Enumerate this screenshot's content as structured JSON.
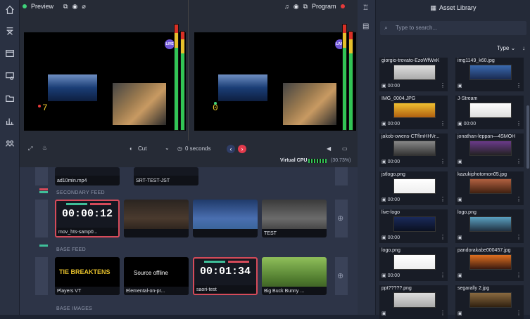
{
  "preview": {
    "title": "Preview",
    "counter": "7"
  },
  "program": {
    "title": "Program",
    "counter": "0"
  },
  "live_label": "LIVE",
  "controls": {
    "transition": "Cut",
    "duration": "0 seconds"
  },
  "virtual_cpu": {
    "label": "Virtual CPU",
    "value": "(30.73%)"
  },
  "top_row": {
    "items": [
      "ad10min.mp4",
      "SRT-TEST-JST"
    ]
  },
  "secondary_feed": {
    "label": "SECONDARY FEED",
    "items": [
      {
        "name": "mov_hts-samp0...",
        "timer": "00:00:12"
      },
      {
        "name": ""
      },
      {
        "name": ""
      },
      {
        "name": "TEST"
      }
    ]
  },
  "base_feed": {
    "label": "BASE FEED",
    "items": [
      {
        "name": "Players VT",
        "overlay": "TIE BREAKTENS"
      },
      {
        "name": "Elemental-on-pr...",
        "overlay": "Source offline"
      },
      {
        "name": "saori-test",
        "timer": "00:01:34"
      },
      {
        "name": "Big Buck Bunny ..."
      }
    ]
  },
  "base_images": {
    "label": "BASE IMAGES"
  },
  "assets": {
    "title": "Asset Library",
    "search_placeholder": "Type to search...",
    "sort_label": "Type",
    "items": [
      {
        "name": "giorgio-trovato-EzoWfWxKq...",
        "meta": "00:00"
      },
      {
        "name": "img1149_k60.jpg",
        "meta": ""
      },
      {
        "name": "IMG_0004.JPG",
        "meta": "00:00"
      },
      {
        "name": "J-Stream",
        "meta": "00:00"
      },
      {
        "name": "jakob-owens-CTflmHHVr...",
        "meta": "00:00"
      },
      {
        "name": "jonathan-leppan—4SMOH...",
        "meta": ""
      },
      {
        "name": "jstlogo.png",
        "meta": "00:00"
      },
      {
        "name": "kazukiphotomon05.jpg",
        "meta": ""
      },
      {
        "name": "live-logo",
        "meta": "00:00"
      },
      {
        "name": "logo.png",
        "meta": ""
      },
      {
        "name": "logo.png",
        "meta": "00:00"
      },
      {
        "name": "pandorakabe000457.jpg",
        "meta": ""
      },
      {
        "name": "ppt?????.png",
        "meta": ""
      },
      {
        "name": "segarally 2.jpg",
        "meta": ""
      }
    ]
  }
}
